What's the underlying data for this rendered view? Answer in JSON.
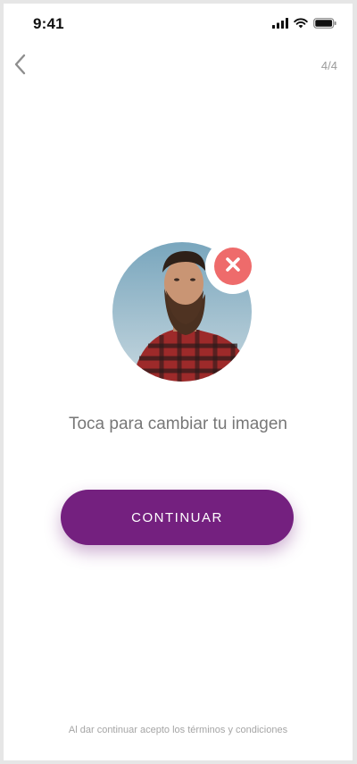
{
  "status_bar": {
    "time": "9:41",
    "icons": [
      "cellular-signal-icon",
      "wifi-icon",
      "battery-icon"
    ]
  },
  "nav": {
    "back_icon": "chevron-left-icon",
    "step_counter": "4/4"
  },
  "profile": {
    "avatar_description": "profile-photo",
    "remove_icon": "close-icon",
    "change_hint": "Toca para cambiar tu imagen"
  },
  "actions": {
    "continue_label": "CONTINUAR"
  },
  "footer": {
    "terms": "Al dar continuar acepto los términos y condiciones"
  },
  "colors": {
    "primary": "#74207f",
    "remove": "#ee6b6b",
    "muted_text": "#777777",
    "light_text": "#a5a5a5"
  }
}
